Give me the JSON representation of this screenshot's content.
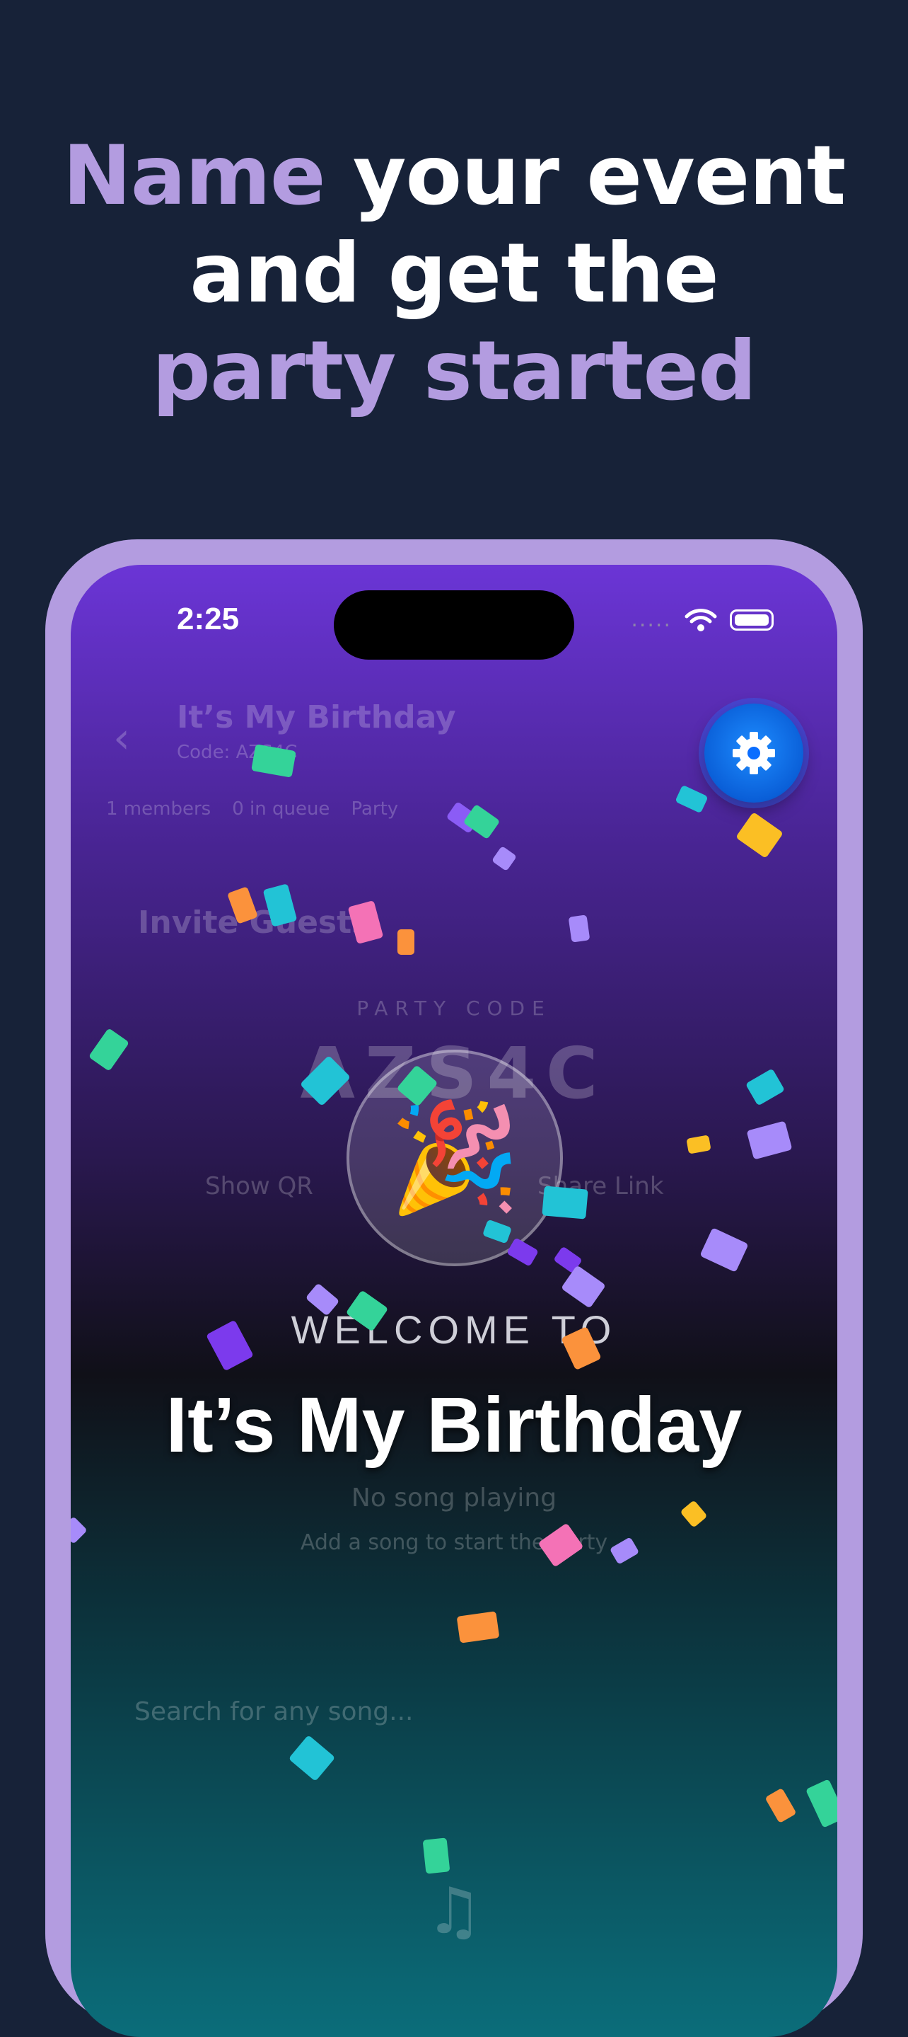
{
  "headline": {
    "line1_accent": "Name",
    "line1_rest": " your event",
    "line2": "and get the",
    "line3_accent": "party started"
  },
  "status_bar": {
    "time": "2:25",
    "signal": "....."
  },
  "underlay": {
    "back": "‹",
    "title": "It’s My Birthday",
    "subtitle": "Code: AZS4C",
    "members": "1 members",
    "queue": "0 in queue",
    "party": "Party",
    "invite": "Invite Guests",
    "code_label": "PARTY CODE",
    "code": "AZS4C",
    "show_qr": "Show QR",
    "share_link": "Share Link",
    "no_song": "No song playing",
    "no_song_sub": "Add a song to start the party",
    "search_placeholder": "Search for any song...",
    "music_icon": "music-note-icon"
  },
  "welcome": {
    "label": "WELCOME TO",
    "event_name": "It’s My Birthday",
    "emoji": "🎉"
  },
  "colors": {
    "background": "#172238",
    "accent": "#b39ce0",
    "settings_button": "#0a6dff"
  }
}
